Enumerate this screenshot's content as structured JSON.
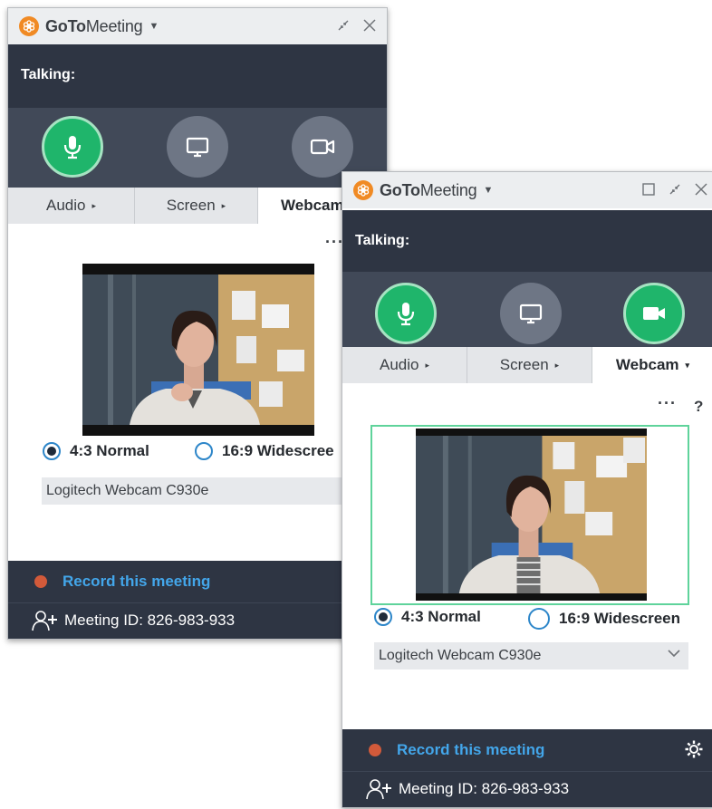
{
  "windows": [
    {
      "app": {
        "brand_prefix": "GoTo",
        "brand_suffix": "Meeting"
      },
      "talking_label": "Talking:",
      "controls": {
        "mic_active": true,
        "screen_active": false,
        "webcam_active": false
      },
      "tabs": [
        {
          "label": "Audio",
          "arrow": "▸"
        },
        {
          "label": "Screen",
          "arrow": "▸"
        },
        {
          "label": "Webcam",
          "arrow": ""
        }
      ],
      "more": "···",
      "help": "",
      "ratio_normal": "4:3 Normal",
      "ratio_wide": "16:9 Widescree",
      "selected_ratio": "normal",
      "camera": "Logitech Webcam C930e",
      "record_label": "Record this meeting",
      "meeting_id": "Meeting ID: 826-983-933"
    },
    {
      "app": {
        "brand_prefix": "GoTo",
        "brand_suffix": "Meeting"
      },
      "talking_label": "Talking:",
      "controls": {
        "mic_active": true,
        "screen_active": false,
        "webcam_active": true
      },
      "tabs": [
        {
          "label": "Audio",
          "arrow": "▸"
        },
        {
          "label": "Screen",
          "arrow": "▸"
        },
        {
          "label": "Webcam",
          "arrow": "▾"
        }
      ],
      "more": "···",
      "help": "?",
      "ratio_normal": "4:3 Normal",
      "ratio_wide": "16:9 Widescreen",
      "selected_ratio": "normal",
      "camera": "Logitech Webcam C930e",
      "record_label": "Record this meeting",
      "meeting_id": "Meeting ID: 826-983-933"
    }
  ],
  "colors": {
    "accent_green": "#1fb56b",
    "record_blue": "#43a6ea",
    "dark_bar": "#2e3543",
    "logo_orange": "#f08a24"
  }
}
